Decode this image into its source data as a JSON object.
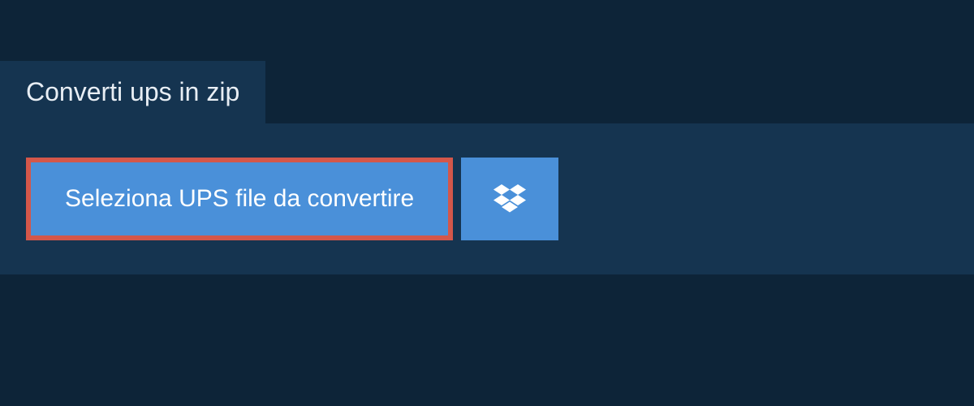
{
  "tab": {
    "title": "Converti ups in zip"
  },
  "buttons": {
    "select_file_label": "Seleziona UPS file da convertire"
  }
}
